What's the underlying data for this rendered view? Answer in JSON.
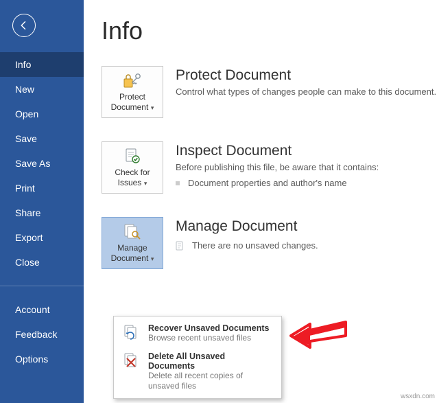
{
  "sidebar": {
    "items": [
      {
        "label": "Info"
      },
      {
        "label": "New"
      },
      {
        "label": "Open"
      },
      {
        "label": "Save"
      },
      {
        "label": "Save As"
      },
      {
        "label": "Print"
      },
      {
        "label": "Share"
      },
      {
        "label": "Export"
      },
      {
        "label": "Close"
      }
    ],
    "footer": [
      {
        "label": "Account"
      },
      {
        "label": "Feedback"
      },
      {
        "label": "Options"
      }
    ]
  },
  "page": {
    "title": "Info"
  },
  "protect": {
    "tile_line1": "Protect",
    "tile_line2": "Document",
    "title": "Protect Document",
    "desc": "Control what types of changes people can make to this document."
  },
  "inspect": {
    "tile_line1": "Check for",
    "tile_line2": "Issues",
    "title": "Inspect Document",
    "desc": "Before publishing this file, be aware that it contains:",
    "bullet": "Document properties and author's name"
  },
  "manage": {
    "tile_line1": "Manage",
    "tile_line2": "Document",
    "title": "Manage Document",
    "desc": "There are no unsaved changes."
  },
  "menu": {
    "recover_title": "Recover Unsaved Documents",
    "recover_desc": "Browse recent unsaved files",
    "delete_title": "Delete All Unsaved Documents",
    "delete_desc": "Delete all recent copies of unsaved files"
  },
  "watermark": "wsxdn.com"
}
